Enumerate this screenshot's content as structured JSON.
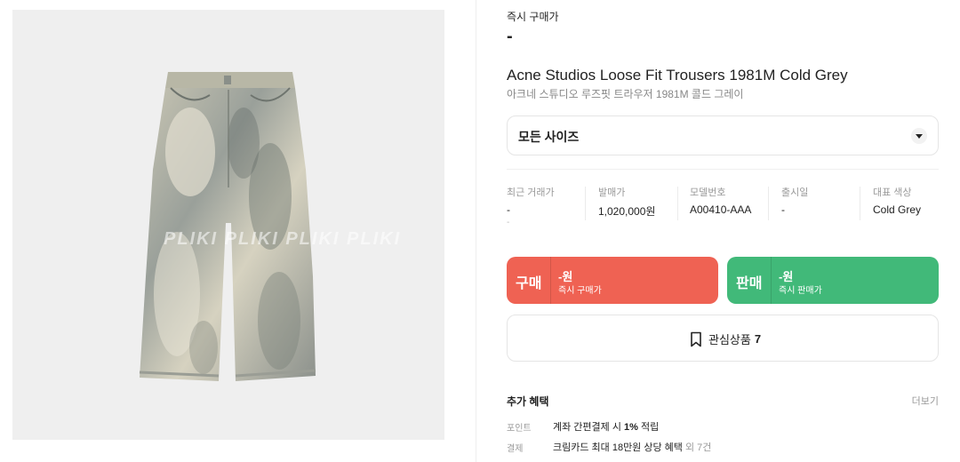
{
  "product": {
    "watermark": "PLIKI   PLIKI   PLIKI   PLIKI",
    "instant_buy_label": "즉시 구매가",
    "instant_buy_price": "-",
    "title_en": "Acne Studios Loose Fit Trousers 1981M Cold Grey",
    "title_ko": "아크네 스튜디오 루즈핏 트라우저 1981M 콜드 그레이"
  },
  "size_select": {
    "label": "모든 사이즈",
    "icon": "chevron-down-icon"
  },
  "stats": [
    {
      "label": "최근 거래가",
      "value": "-",
      "sub": "-"
    },
    {
      "label": "발매가",
      "value": "1,020,000원"
    },
    {
      "label": "모델번호",
      "value": "A00410-AAA"
    },
    {
      "label": "출시일",
      "value": "-"
    },
    {
      "label": "대표 색상",
      "value": "Cold Grey"
    }
  ],
  "buy": {
    "label": "구매",
    "price": "-원",
    "sub": "즉시 구매가",
    "color": "#ef6253"
  },
  "sell": {
    "label": "판매",
    "price": "-원",
    "sub": "즉시 판매가",
    "color": "#41b979"
  },
  "wishlist": {
    "label": "관심상품",
    "count": "7",
    "icon": "bookmark-icon"
  },
  "benefits": {
    "title": "추가 혜택",
    "more": "더보기",
    "rows": [
      {
        "key": "포인트",
        "text": "계좌 간편결제 시 ",
        "bold": "1%",
        "text2": " 적립",
        "extra": ""
      },
      {
        "key": "결제",
        "text": "크림카드 최대 18만원 상당 혜택",
        "bold": "",
        "text2": "",
        "extra": " 외 7건"
      }
    ]
  }
}
